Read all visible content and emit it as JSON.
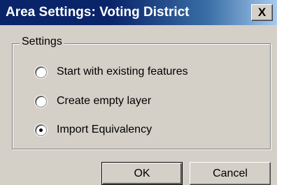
{
  "window": {
    "title": "Area Settings: Voting District",
    "close_label": "X"
  },
  "settings": {
    "group_label": "Settings",
    "options": [
      {
        "label": "Start with existing features",
        "selected": false
      },
      {
        "label": "Create empty layer",
        "selected": false
      },
      {
        "label": "Import Equivalency",
        "selected": true
      }
    ]
  },
  "buttons": {
    "ok": "OK",
    "cancel": "Cancel"
  },
  "colors": {
    "title_bar": "#0a246a",
    "face": "#d4d0c8"
  }
}
